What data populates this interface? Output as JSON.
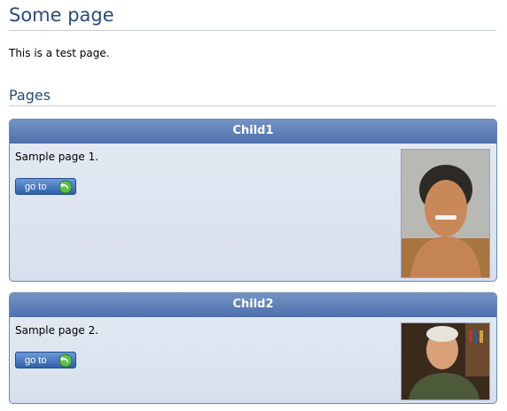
{
  "page": {
    "title": "Some page",
    "intro": "This is a test page."
  },
  "section": {
    "title": "Pages"
  },
  "cards": [
    {
      "title": "Child1",
      "text": "Sample page 1.",
      "button": "go to"
    },
    {
      "title": "Child2",
      "text": "Sample page 2.",
      "button": "go to"
    }
  ],
  "colors": {
    "heading": "#2c4a7a",
    "card_header": "#5b7cb6",
    "card_body": "#dfe5f0"
  }
}
